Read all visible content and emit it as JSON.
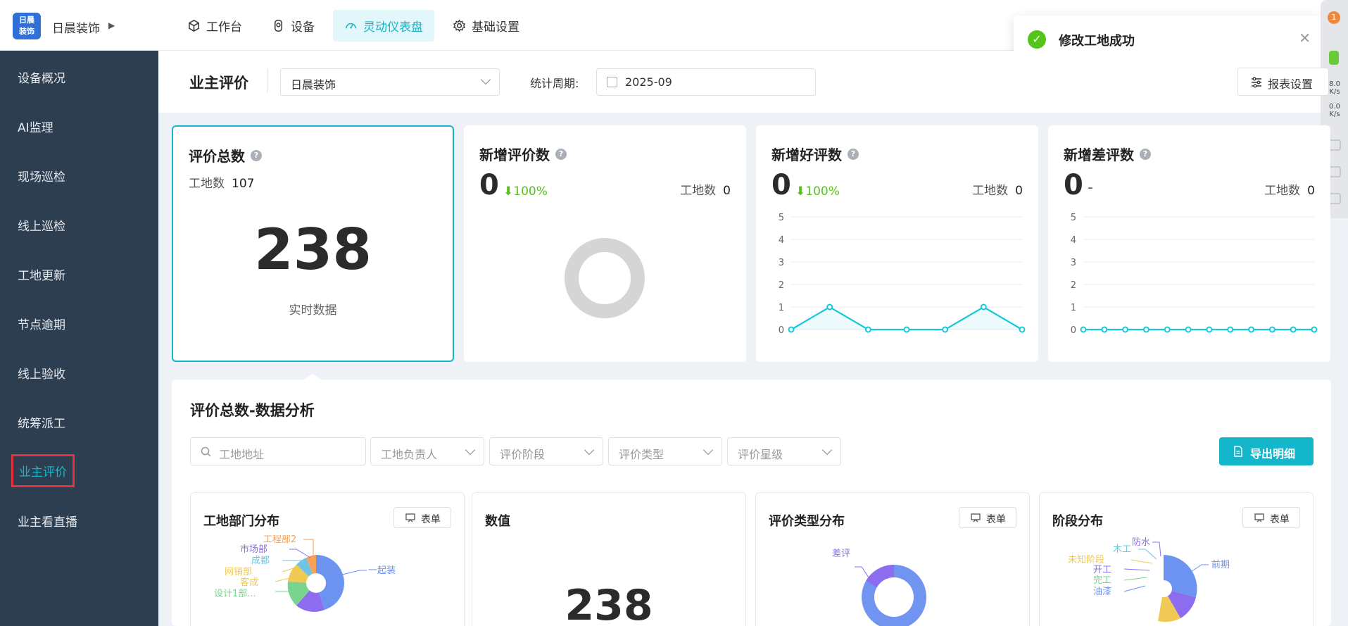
{
  "topbar": {
    "logo_text_line1": "日晨",
    "logo_text_line2": "装饰",
    "company": "日晨装饰",
    "nav": [
      {
        "label": "工作台",
        "icon": "cube-icon"
      },
      {
        "label": "设备",
        "icon": "device-icon"
      },
      {
        "label": "灵动仪表盘",
        "icon": "dashboard-icon",
        "active": true
      },
      {
        "label": "基础设置",
        "icon": "gear-icon"
      }
    ]
  },
  "toast": {
    "message": "修改工地成功"
  },
  "float_strip": {
    "badge": "1",
    "up_speed": "8.0",
    "up_unit": "K/s",
    "down_speed": "0.0",
    "down_unit": "K/s"
  },
  "sidebar": {
    "items": [
      {
        "label": "设备概况"
      },
      {
        "label": "AI监理"
      },
      {
        "label": "现场巡检"
      },
      {
        "label": "线上巡检"
      },
      {
        "label": "工地更新"
      },
      {
        "label": "节点逾期"
      },
      {
        "label": "线上验收"
      },
      {
        "label": "统筹派工"
      },
      {
        "label": "业主评价",
        "active": true
      },
      {
        "label": "业主看直播"
      }
    ]
  },
  "header": {
    "title": "业主评价",
    "company_select": "日晨装饰",
    "period_label": "统计周期:",
    "period_value": "2025-09",
    "report_button": "报表设置"
  },
  "cards": {
    "total": {
      "title": "评价总数",
      "site_label": "工地数",
      "site_count": "107",
      "value": "238",
      "subtitle": "实时数据"
    },
    "new_reviews": {
      "title": "新增评价数",
      "value": "0",
      "delta": "100%",
      "site_label": "工地数",
      "site_count": "0"
    },
    "new_good": {
      "title": "新增好评数",
      "value": "0",
      "delta": "100%",
      "site_label": "工地数",
      "site_count": "0"
    },
    "new_bad": {
      "title": "新增差评数",
      "value": "0",
      "delta": "-",
      "site_label": "工地数",
      "site_count": "0"
    }
  },
  "analysis": {
    "title": "评价总数-数据分析",
    "filters": {
      "address_placeholder": "工地地址",
      "manager": "工地负责人",
      "stage": "评价阶段",
      "type": "评价类型",
      "stars": "评价星级"
    },
    "export_button": "导出明细",
    "form_label": "表单",
    "value_card": {
      "title": "数值",
      "value": "238"
    },
    "dept_card": {
      "title": "工地部门分布",
      "labels": [
        "工程部2",
        "市场部",
        "成都",
        "网销部",
        "客成",
        "设计1部...",
        "一起装"
      ]
    },
    "type_card": {
      "title": "评价类型分布",
      "labels": [
        "差评"
      ]
    },
    "stage_card": {
      "title": "阶段分布",
      "labels": [
        "防水",
        "木工",
        "未知阶段",
        "开工",
        "完工",
        "油漆",
        "前期"
      ]
    }
  },
  "chart_data": [
    {
      "type": "line",
      "title": "新增好评数",
      "y_ticks": [
        0,
        1,
        2,
        3,
        4,
        5
      ],
      "ylim": [
        0,
        5
      ],
      "values": [
        0,
        1,
        0,
        0,
        0,
        1,
        0
      ]
    },
    {
      "type": "line",
      "title": "新增差评数",
      "y_ticks": [
        0,
        1,
        2,
        3,
        4,
        5
      ],
      "ylim": [
        0,
        5
      ],
      "values": [
        0,
        0,
        0,
        0,
        0,
        0,
        0,
        0,
        0,
        0,
        0,
        0
      ]
    }
  ],
  "colors": {
    "accent": "#14b6cc",
    "sidebar_bg": "#2d3e50",
    "success": "#52c41a",
    "line": "#17c8da"
  }
}
